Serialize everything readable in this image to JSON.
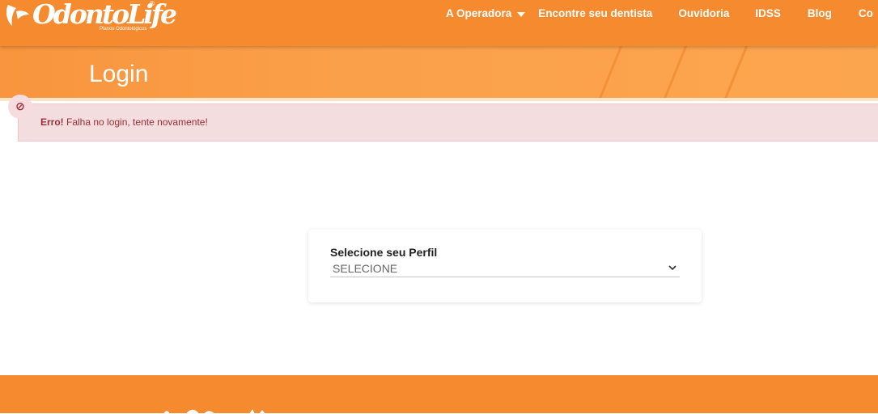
{
  "header": {
    "logo_text": "OdontoLife",
    "logo_reg": "®",
    "logo_subtitle": "Planos Odontológicos",
    "nav": [
      {
        "label": "A Operadora",
        "has_dropdown": true
      },
      {
        "label": "Encontre seu dentista"
      },
      {
        "label": "Ouvidoria"
      },
      {
        "label": "IDSS"
      },
      {
        "label": "Blog"
      },
      {
        "label": "Co"
      }
    ]
  },
  "page": {
    "title": "Login"
  },
  "alert": {
    "strong": "Erro!",
    "message": " Falha no login, tente novamente!",
    "icon": "block-icon"
  },
  "login_card": {
    "label": "Selecione seu Perfil",
    "select_value": "SELECIONE"
  },
  "colors": {
    "brand_orange": "#f58a2e",
    "banner_orange": "#fca54f",
    "alert_bg": "#f3dddf",
    "alert_text": "#9a2e38"
  }
}
